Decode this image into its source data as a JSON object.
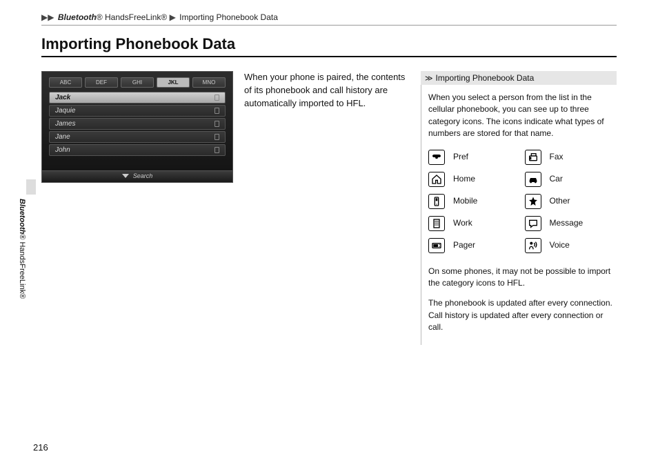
{
  "breadcrumb": {
    "a": "Bluetooth",
    "a_suffix": "® HandsFreeLink®",
    "b": "Importing Phonebook Data"
  },
  "title": "Importing Phonebook Data",
  "intro": "When your phone is paired, the contents of its phonebook and call history are automatically imported to HFL.",
  "screenshot": {
    "tabs": [
      "ABC",
      "DEF",
      "GHI",
      "JKL",
      "MNO"
    ],
    "selected_tab_index": 3,
    "rows": [
      "Jack",
      "Jaquie",
      "James",
      "Jane",
      "John"
    ],
    "selected_row_index": 0,
    "search": "Search"
  },
  "side": {
    "a": "Bluetooth",
    "a_suffix": "® HandsFreeLink®"
  },
  "note": {
    "head": "Importing Phonebook Data",
    "p1": "When you select a person from the list in the cellular phonebook, you can see up to three category icons. The icons indicate what types of numbers are stored for that name.",
    "categories": [
      {
        "label": "Pref",
        "icon": "phone-icon"
      },
      {
        "label": "Fax",
        "icon": "fax-icon"
      },
      {
        "label": "Home",
        "icon": "house-icon"
      },
      {
        "label": "Car",
        "icon": "car-icon"
      },
      {
        "label": "Mobile",
        "icon": "mobile-icon"
      },
      {
        "label": "Other",
        "icon": "star-icon"
      },
      {
        "label": "Work",
        "icon": "building-icon"
      },
      {
        "label": "Message",
        "icon": "message-icon"
      },
      {
        "label": "Pager",
        "icon": "pager-icon"
      },
      {
        "label": "Voice",
        "icon": "voice-icon"
      }
    ],
    "p2": "On some phones, it may not be possible to import the category icons to HFL.",
    "p3": "The phonebook is updated after every connection. Call history is updated after every connection or call."
  },
  "page_number": "216"
}
